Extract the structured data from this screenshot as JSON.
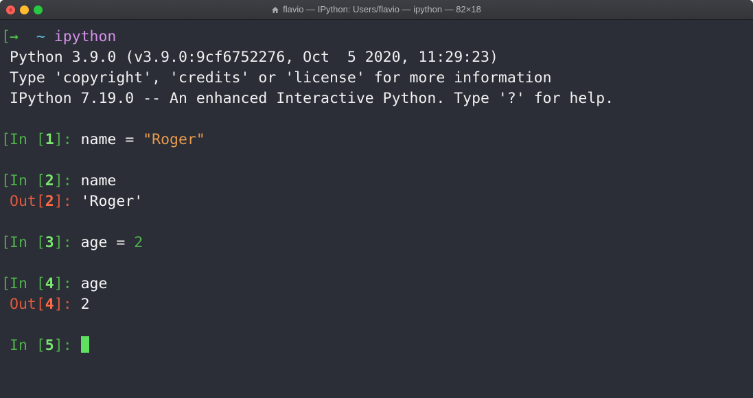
{
  "window": {
    "title": "flavio — IPython: Users/flavio — ipython — 82×18"
  },
  "shell": {
    "arrow": "→",
    "tilde": "~",
    "command": "ipython"
  },
  "banner": [
    "Python 3.9.0 (v3.9.0:9cf6752276, Oct  5 2020, 11:29:23)",
    "Type 'copyright', 'credits' or 'license' for more information",
    "IPython 7.19.0 -- An enhanced Interactive Python. Type '?' for help."
  ],
  "cells": [
    {
      "in_label": "In",
      "in_num": "1",
      "code_pre": "name = ",
      "code_str": "\"Roger\""
    },
    {
      "in_label": "In",
      "in_num": "2",
      "code": "name",
      "out_label": "Out",
      "out_num": "2",
      "out_value": "'Roger'"
    },
    {
      "in_label": "In",
      "in_num": "3",
      "code_pre": "age = ",
      "code_num": "2"
    },
    {
      "in_label": "In",
      "in_num": "4",
      "code": "age",
      "out_label": "Out",
      "out_num": "4",
      "out_value": "2"
    },
    {
      "in_label": "In",
      "in_num": "5"
    }
  ],
  "colors": {
    "background": "#2b2e37",
    "prompt_in": "#4fb34a",
    "prompt_out": "#e35a3c",
    "string": "#e89a4d",
    "cursor": "#5fe060",
    "shell_command": "#d591e8"
  }
}
